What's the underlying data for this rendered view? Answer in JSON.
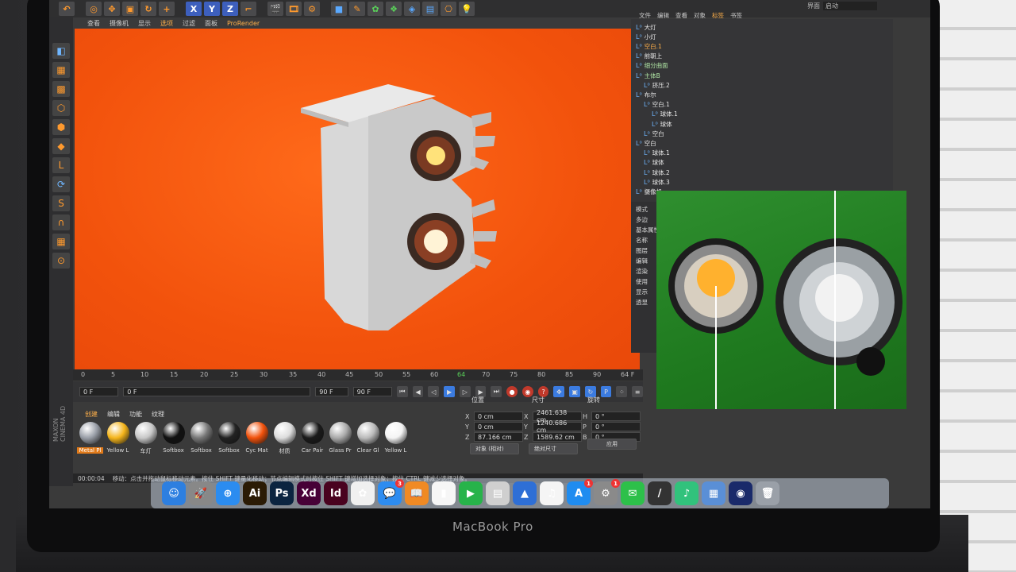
{
  "device": {
    "brand": "MacBook Pro"
  },
  "toolbar": {
    "axis_labels": [
      "X",
      "Y",
      "Z"
    ]
  },
  "top_right": {
    "layout_label": "界面",
    "layout_value": "启动"
  },
  "viewport_menu": {
    "items": [
      "查看",
      "摄像机",
      "显示",
      "选项",
      "过滤",
      "面板"
    ],
    "active": "选项",
    "plugin": "ProRender"
  },
  "timeline": {
    "ticks": [
      "0",
      "5",
      "10",
      "15",
      "20",
      "25",
      "30",
      "35",
      "40",
      "45",
      "50",
      "55",
      "60",
      "64",
      "70",
      "75",
      "80",
      "85",
      "90"
    ],
    "current_frame_label": "64",
    "end_label": "64 F",
    "start_field": "0 F",
    "start_field2": "0 F",
    "end_field": "90 F",
    "end_field2": "90 F"
  },
  "material_manager": {
    "menu": [
      "创建",
      "编辑",
      "功能",
      "纹理"
    ],
    "active_menu": "创建",
    "brand_text": "MAXON CINEMA 4D",
    "materials": [
      {
        "label": "Metal Pl",
        "color": "#9a9fa8",
        "selected": true
      },
      {
        "label": "Yellow L",
        "color": "#f5b51b",
        "selected": false
      },
      {
        "label": "车灯",
        "color": "#c8c8c8",
        "selected": false
      },
      {
        "label": "Softbox",
        "color": "#111111",
        "selected": false
      },
      {
        "label": "Softbox",
        "color": "#777777",
        "selected": false
      },
      {
        "label": "Softbox",
        "color": "#222222",
        "selected": false
      },
      {
        "label": "Cyc Mat",
        "color": "#f2520c",
        "selected": false
      },
      {
        "label": "材质",
        "color": "#dddddd",
        "selected": false
      },
      {
        "label": "Car Pair",
        "color": "#1a1a1a",
        "selected": false
      },
      {
        "label": "Glass Pr",
        "color": "#aaaaaa",
        "selected": false
      },
      {
        "label": "Clear Gl",
        "color": "#bbbbbb",
        "selected": false
      },
      {
        "label": "Yellow L",
        "color": "#f4f4f4",
        "selected": false
      }
    ]
  },
  "coordinates": {
    "headers": [
      "位置",
      "尺寸",
      "旋转"
    ],
    "position": [
      {
        "axis": "X",
        "value": "0 cm"
      },
      {
        "axis": "Y",
        "value": "0 cm"
      },
      {
        "axis": "Z",
        "value": "87.166 cm"
      }
    ],
    "size": [
      {
        "axis": "X",
        "value": "2461.638 cm"
      },
      {
        "axis": "Y",
        "value": "1240.686 cm"
      },
      {
        "axis": "Z",
        "value": "1589.62 cm"
      }
    ],
    "rotation": [
      {
        "axis": "H",
        "value": "0 °"
      },
      {
        "axis": "P",
        "value": "0 °"
      },
      {
        "axis": "B",
        "value": "0 °"
      }
    ],
    "mode_select": "对象 (相对)",
    "size_select": "绝对尺寸",
    "apply_label": "应用"
  },
  "statusbar": {
    "time": "00:00:04",
    "message": "移动：点击并拖动鼠标移动元素。按住 SHIFT 键量化移动；节点编辑模式时按住 SHIFT 键增加选择对象；按住 CTRL 键减少选择对象。"
  },
  "object_manager": {
    "menu": [
      "文件",
      "编辑",
      "查看",
      "对象",
      "标签",
      "书签"
    ],
    "active_menu": "标签",
    "objects": [
      {
        "name": "大灯",
        "indent": 0,
        "style": "normal"
      },
      {
        "name": "小灯",
        "indent": 0,
        "style": "normal"
      },
      {
        "name": "空白.1",
        "indent": 0,
        "style": "hl"
      },
      {
        "name": "前朝上",
        "indent": 0,
        "style": "normal"
      },
      {
        "name": "细分曲面",
        "indent": 0,
        "style": "green"
      },
      {
        "name": "主体B",
        "indent": 0,
        "style": "green"
      },
      {
        "name": "挤压.2",
        "indent": 1,
        "style": "normal"
      },
      {
        "name": "布尔",
        "indent": 0,
        "style": "normal"
      },
      {
        "name": "空白.1",
        "indent": 1,
        "style": "normal"
      },
      {
        "name": "球体.1",
        "indent": 2,
        "style": "normal"
      },
      {
        "name": "球体",
        "indent": 2,
        "style": "normal"
      },
      {
        "name": "空白",
        "indent": 1,
        "style": "normal"
      },
      {
        "name": "空白",
        "indent": 0,
        "style": "normal"
      },
      {
        "name": "球体.1",
        "indent": 1,
        "style": "normal"
      },
      {
        "name": "球体",
        "indent": 1,
        "style": "normal"
      },
      {
        "name": "球体.2",
        "indent": 1,
        "style": "normal"
      },
      {
        "name": "球体.3",
        "indent": 1,
        "style": "normal"
      },
      {
        "name": "摄像机",
        "indent": 0,
        "style": "normal"
      }
    ]
  },
  "attribute_manager": {
    "items": [
      "模式",
      "多边",
      "基本属性",
      "名称",
      "图层",
      "编辑",
      "渲染",
      "使用",
      "显示",
      "透显"
    ]
  },
  "dock": {
    "apps": [
      {
        "name": "Finder",
        "text": "☺",
        "bg": "#2d7fe0",
        "badge": ""
      },
      {
        "name": "Launchpad",
        "text": "🚀",
        "bg": "#888888",
        "badge": ""
      },
      {
        "name": "Safari",
        "text": "⊕",
        "bg": "#2b8cf0",
        "badge": ""
      },
      {
        "name": "Illustrator",
        "text": "Ai",
        "bg": "#2b1b05",
        "badge": ""
      },
      {
        "name": "Photoshop",
        "text": "Ps",
        "bg": "#0b2440",
        "badge": ""
      },
      {
        "name": "XD",
        "text": "Xd",
        "bg": "#470137",
        "badge": ""
      },
      {
        "name": "InDesign",
        "text": "Id",
        "bg": "#49021f",
        "badge": ""
      },
      {
        "name": "Photos",
        "text": "✿",
        "bg": "#f0f0f0",
        "badge": ""
      },
      {
        "name": "Messages",
        "text": "💬",
        "bg": "#2d8cf0",
        "badge": "3"
      },
      {
        "name": "Books",
        "text": "📖",
        "bg": "#f08a24",
        "badge": ""
      },
      {
        "name": "Numbers",
        "text": "▮",
        "bg": "#f6f6f6",
        "badge": ""
      },
      {
        "name": "FaceTime",
        "text": "▶",
        "bg": "#27b34a",
        "badge": ""
      },
      {
        "name": "Preview",
        "text": "▤",
        "bg": "#cfcfcf",
        "badge": ""
      },
      {
        "name": "Keynote",
        "text": "▲",
        "bg": "#2e6fd6",
        "badge": ""
      },
      {
        "name": "Music",
        "text": "♫",
        "bg": "#f5f5f5",
        "badge": ""
      },
      {
        "name": "App Store",
        "text": "A",
        "bg": "#1f8cf0",
        "badge": "1"
      },
      {
        "name": "System Preferences",
        "text": "⚙",
        "bg": "#8a8a8a",
        "badge": "1"
      },
      {
        "name": "WeChat",
        "text": "✉",
        "bg": "#2dc04a",
        "badge": ""
      },
      {
        "name": "Pencil",
        "text": "/",
        "bg": "#333333",
        "badge": ""
      },
      {
        "name": "QQ Music",
        "text": "♪",
        "bg": "#31c27c",
        "badge": ""
      },
      {
        "name": "Photo App",
        "text": "▦",
        "bg": "#5a8fd6",
        "badge": ""
      },
      {
        "name": "Cinema 4D",
        "text": "◉",
        "bg": "#1a2a6a",
        "badge": ""
      },
      {
        "name": "Trash",
        "text": "🗑",
        "bg": "#9aa0a8",
        "badge": ""
      }
    ]
  },
  "colors": {
    "viewport_bg": "#f2520c",
    "accent": "#ffb04a",
    "reference_green": "#2f8f2f"
  }
}
